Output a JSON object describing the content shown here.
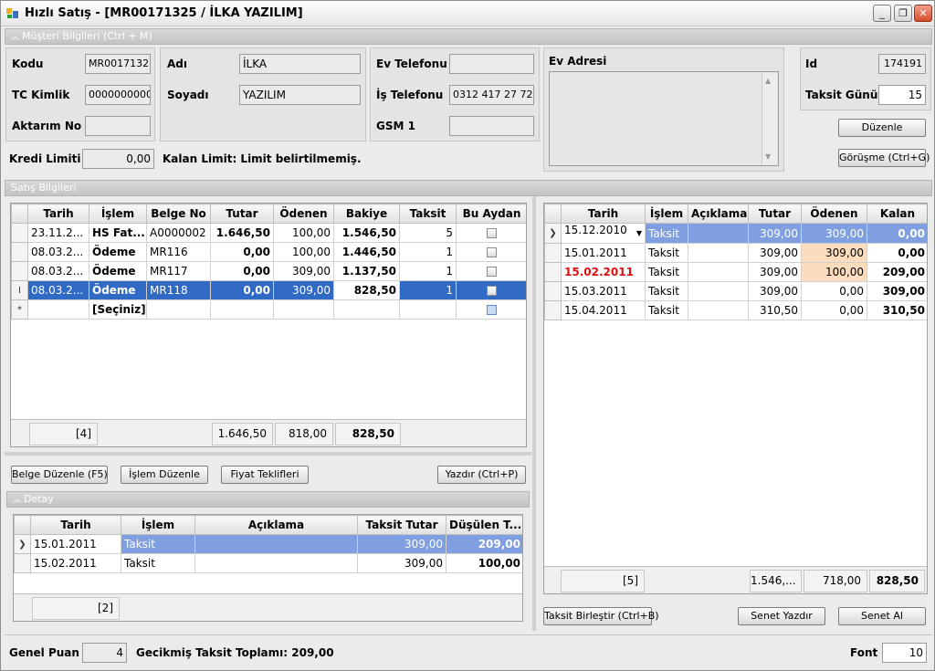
{
  "window": {
    "title": "Hızlı Satış - [MR00171325 / İLKA YAZILIM]",
    "minimize": "_",
    "maximize": "❐",
    "close": "✕"
  },
  "musteri": {
    "section_title": "Müşteri Bilgileri (Ctrl + M)",
    "kodu_label": "Kodu",
    "kodu": "MR0017132",
    "tc_label": "TC Kimlik",
    "tc": "0000000000",
    "aktarim_label": "Aktarım No",
    "aktarim": "",
    "adi_label": "Adı",
    "adi": "İLKA",
    "soyadi_label": "Soyadı",
    "soyadi": "YAZILIM",
    "evtel_label": "Ev Telefonu",
    "evtel": "",
    "istel_label": "İş Telefonu",
    "istel": "0312 417 27 72",
    "gsm_label": "GSM 1",
    "gsm": "",
    "evadres_label": "Ev Adresi",
    "evadres": "",
    "id_label": "Id",
    "id": "174191",
    "taksit_gunu_label": "Taksit Günü",
    "taksit_gunu": "15",
    "duzenle": "Düzenle",
    "gorusme": "Görüşme (Ctrl+G)",
    "kredi_label": "Kredi Limiti",
    "kredi": "0,00",
    "kalan_limit": "Kalan Limit: Limit belirtilmemiş."
  },
  "satis": {
    "section_title": "Satış Bilgileri",
    "columns": [
      "Tarih",
      "İşlem",
      "Belge No",
      "Tutar",
      "Ödenen",
      "Bakiye",
      "Taksit",
      "Bu Aydan"
    ],
    "rows": [
      {
        "tarih": "23.11.2...",
        "islem": "HS Fat...",
        "belge": "A0000002",
        "tutar": "1.646,50",
        "odenen": "100,00",
        "bakiye": "1.546,50",
        "taksit": "5"
      },
      {
        "tarih": "08.03.2...",
        "islem": "Ödeme",
        "belge": "MR116",
        "tutar": "0,00",
        "odenen": "100,00",
        "bakiye": "1.446,50",
        "taksit": "1"
      },
      {
        "tarih": "08.03.2...",
        "islem": "Ödeme",
        "belge": "MR117",
        "tutar": "0,00",
        "odenen": "309,00",
        "bakiye": "1.137,50",
        "taksit": "1"
      },
      {
        "tarih": "08.03.2...",
        "islem": "Ödeme",
        "belge": "MR118",
        "tutar": "0,00",
        "odenen": "309,00",
        "bakiye": "828,50",
        "taksit": "1"
      }
    ],
    "new_row_islem": "[Seçiniz]",
    "footer": {
      "count": "[4]",
      "tutar": "1.646,50",
      "odenen": "818,00",
      "bakiye": "828,50"
    },
    "buttons": {
      "belge_duzenle": "Belge Düzenle (F5)",
      "islem_duzenle": "İşlem Düzenle",
      "fiyat_teklifleri": "Fiyat Teklifleri",
      "yazdir": "Yazdır (Ctrl+P)"
    }
  },
  "detay": {
    "section_title": "Detay",
    "columns": [
      "Tarih",
      "İşlem",
      "Açıklama",
      "Taksit Tutar",
      "Düşülen T..."
    ],
    "rows": [
      {
        "tarih": "15.01.2011",
        "islem": "Taksit",
        "aciklama": "",
        "tutar": "309,00",
        "dusulen": "209,00"
      },
      {
        "tarih": "15.02.2011",
        "islem": "Taksit",
        "aciklama": "",
        "tutar": "309,00",
        "dusulen": "100,00"
      }
    ],
    "footer": {
      "count": "[2]"
    }
  },
  "taksit": {
    "columns": [
      "Tarih",
      "İşlem",
      "Açıklama",
      "Tutar",
      "Ödenen",
      "Kalan"
    ],
    "rows": [
      {
        "tarih": "15.12.2010",
        "islem": "Taksit",
        "aciklama": "",
        "tutar": "309,00",
        "odenen": "309,00",
        "kalan": "0,00"
      },
      {
        "tarih": "15.01.2011",
        "islem": "Taksit",
        "aciklama": "",
        "tutar": "309,00",
        "odenen": "309,00",
        "kalan": "0,00"
      },
      {
        "tarih": "15.02.2011",
        "islem": "Taksit",
        "aciklama": "",
        "tutar": "309,00",
        "odenen": "100,00",
        "kalan": "209,00"
      },
      {
        "tarih": "15.03.2011",
        "islem": "Taksit",
        "aciklama": "",
        "tutar": "309,00",
        "odenen": "0,00",
        "kalan": "309,00"
      },
      {
        "tarih": "15.04.2011",
        "islem": "Taksit",
        "aciklama": "",
        "tutar": "310,50",
        "odenen": "0,00",
        "kalan": "310,50"
      }
    ],
    "footer": {
      "count": "[5]",
      "tutar": "1.546,...",
      "odenen": "718,00",
      "kalan": "828,50"
    },
    "buttons": {
      "birlestir": "Taksit Birleştir (Ctrl+B)",
      "senet_yazdir": "Senet Yazdır",
      "senet_al": "Senet Al"
    }
  },
  "status": {
    "genel_puan_label": "Genel Puan",
    "genel_puan": "4",
    "gecikmis": "Gecikmiş Taksit Toplamı: 209,00",
    "font_label": "Font",
    "font": "10"
  },
  "colors": {
    "selection": "#316ac5",
    "selection_light": "#7f9fe0",
    "peach": "#fbdcbc",
    "overdue": "#e01010"
  }
}
